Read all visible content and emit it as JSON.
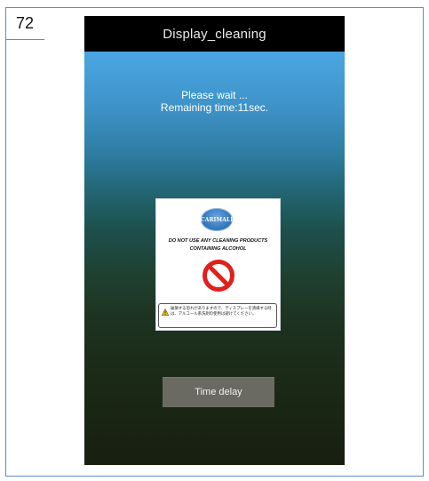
{
  "page_number": "72",
  "screen": {
    "title": "Display_cleaning",
    "message_line1": "Please wait ...",
    "message_line2": "Remaining time:11sec.",
    "notice": {
      "brand": "CARIMALI",
      "warning_line1": "DO NOT USE ANY CLEANING PRODUCTS",
      "warning_line2": "CONTAINING ALCOHOL",
      "japanese_note": "破損する恐れがありますので、ディスプレーを清掃する時は、アルコール系洗剤の使用は避けてください。"
    },
    "button_label": "Time delay"
  },
  "colors": {
    "frame_border": "#5b8ec4",
    "titlebar_bg": "#000000",
    "button_bg": "#6a6a62",
    "prohibition_red": "#e0201c"
  }
}
